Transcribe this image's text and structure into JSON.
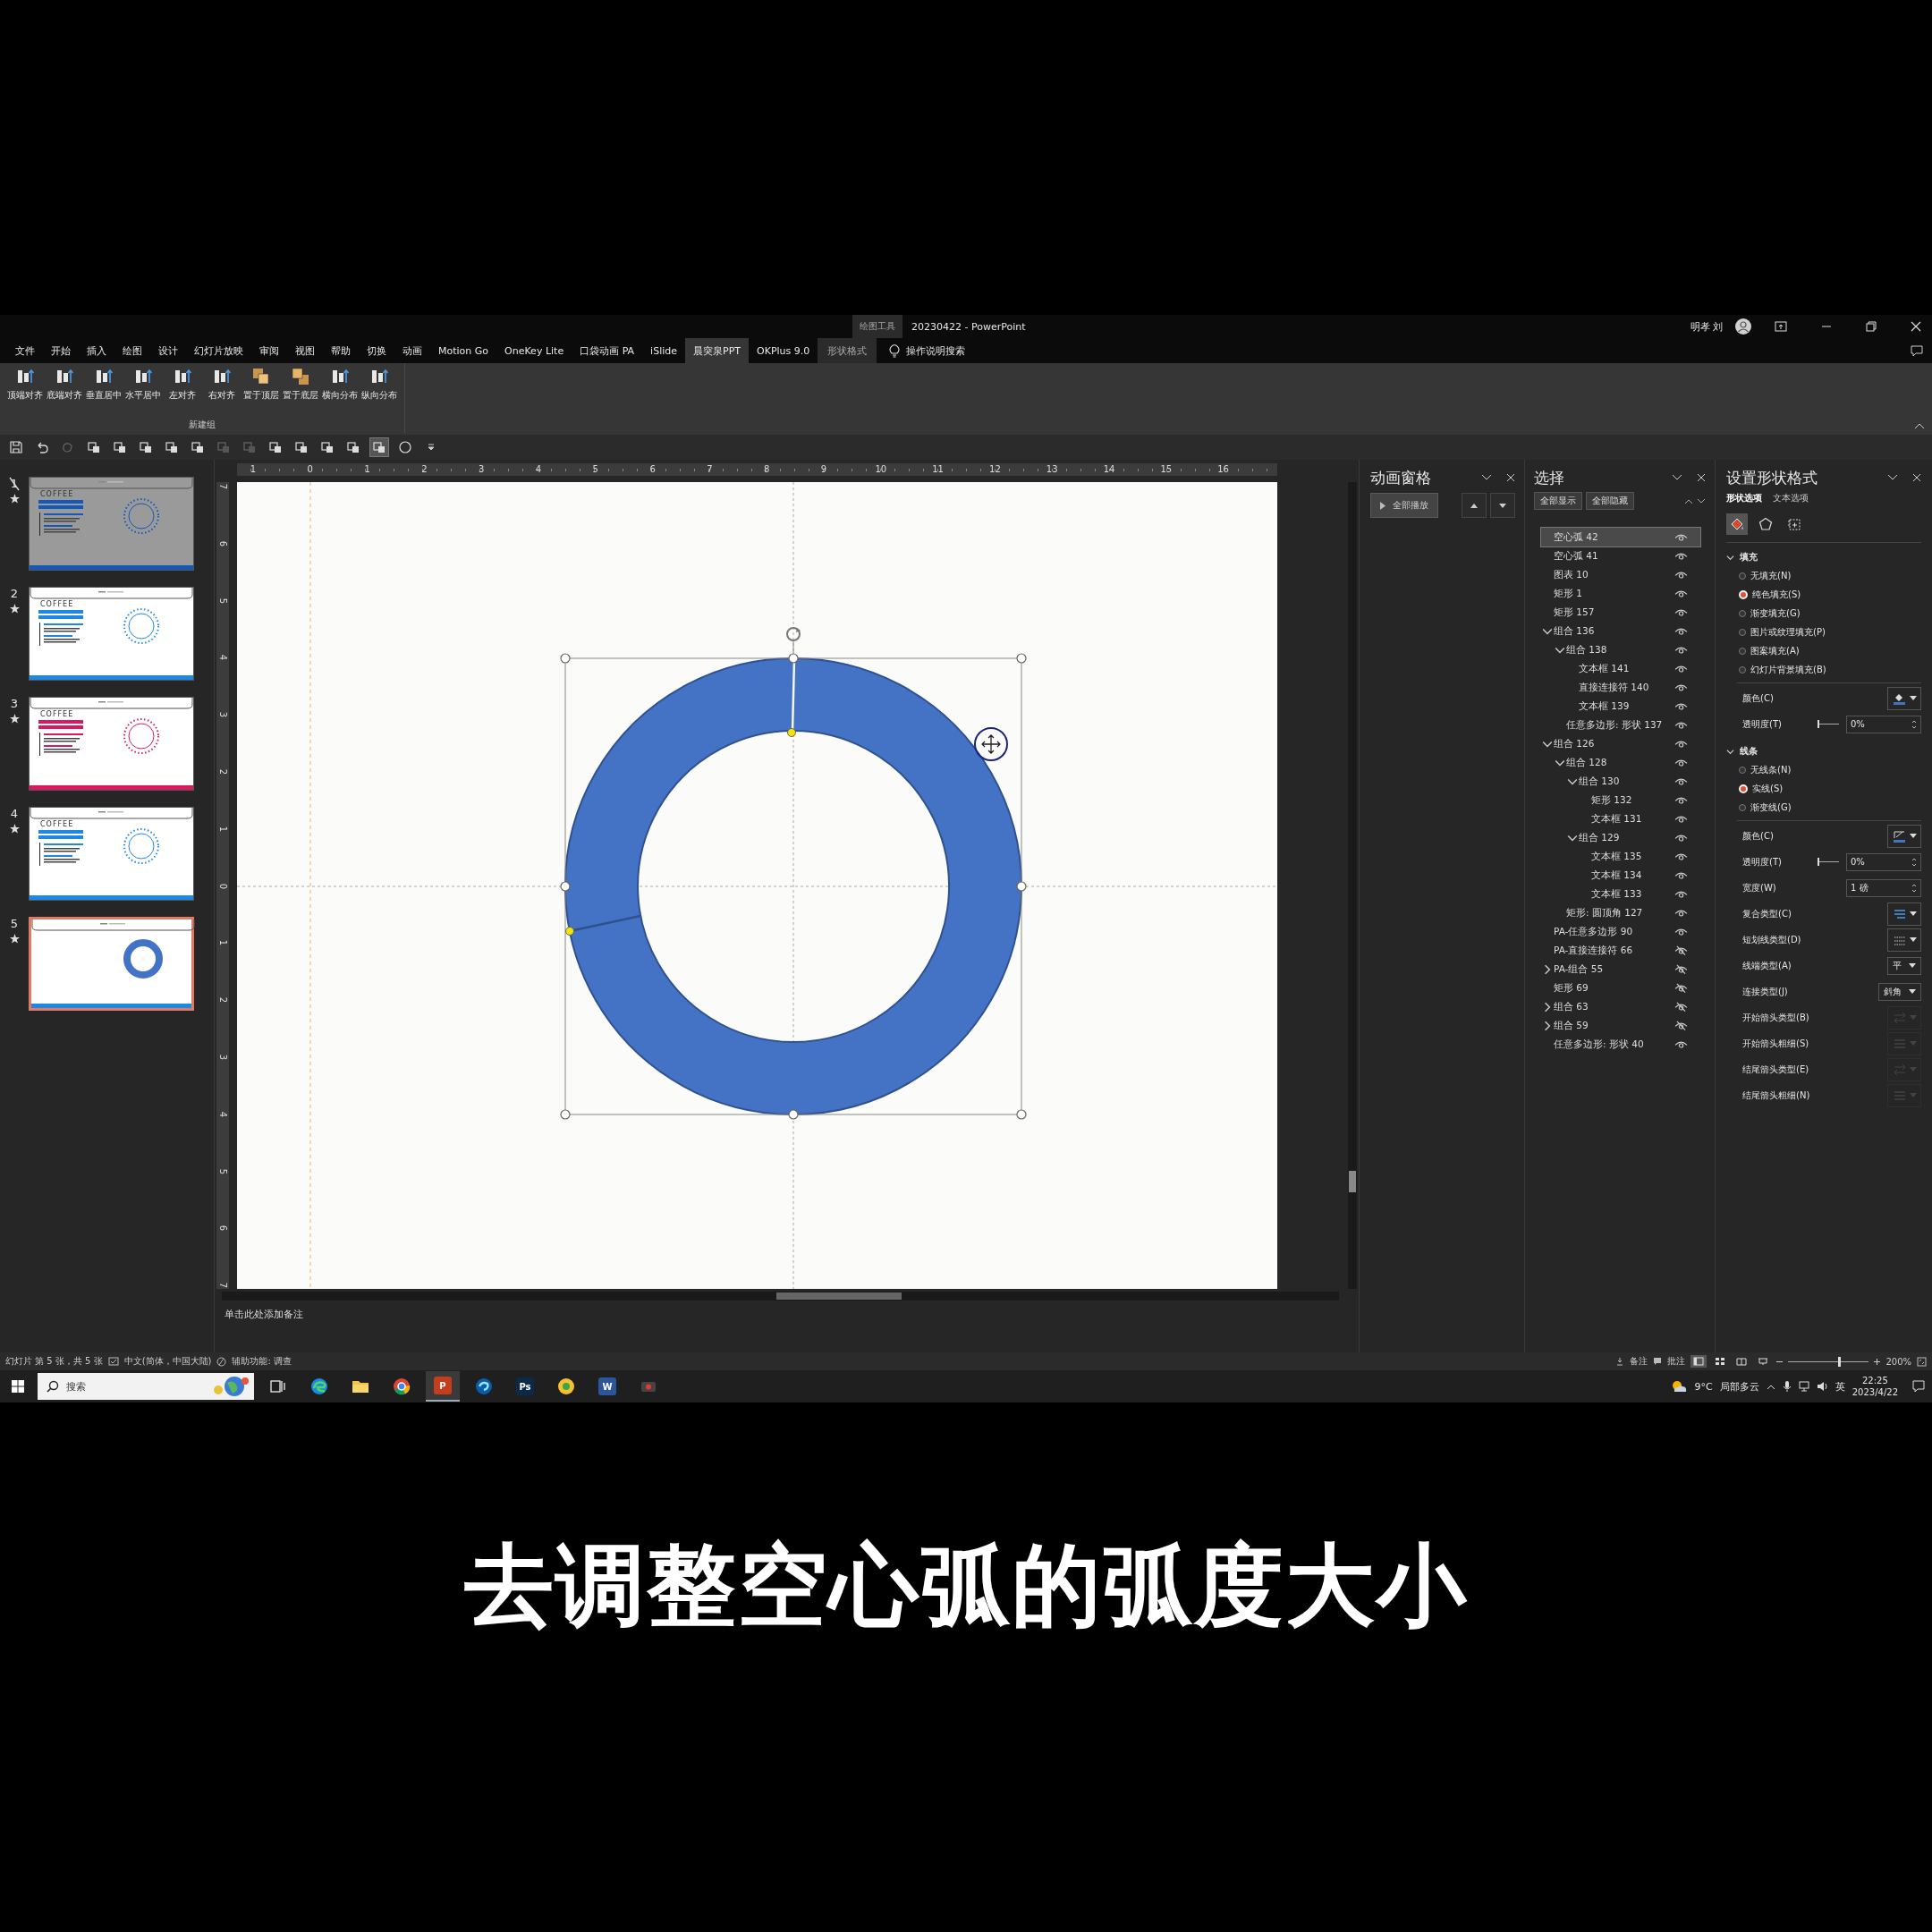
{
  "window": {
    "title": "20230422  -  PowerPoint",
    "context_group": "绘图工具",
    "user": "明孝 刘"
  },
  "menu_tabs": [
    {
      "label": "文件",
      "selected": false,
      "contextual": false
    },
    {
      "label": "开始",
      "selected": false,
      "contextual": false
    },
    {
      "label": "插入",
      "selected": false,
      "contextual": false
    },
    {
      "label": "绘图",
      "selected": false,
      "contextual": false
    },
    {
      "label": "设计",
      "selected": false,
      "contextual": false
    },
    {
      "label": "幻灯片放映",
      "selected": false,
      "contextual": false
    },
    {
      "label": "审阅",
      "selected": false,
      "contextual": false
    },
    {
      "label": "视图",
      "selected": false,
      "contextual": false
    },
    {
      "label": "帮助",
      "selected": false,
      "contextual": false
    },
    {
      "label": "切换",
      "selected": false,
      "contextual": false
    },
    {
      "label": "动画",
      "selected": false,
      "contextual": false
    },
    {
      "label": "Motion Go",
      "selected": false,
      "contextual": false
    },
    {
      "label": "OneKey Lite",
      "selected": false,
      "contextual": false
    },
    {
      "label": "口袋动画 PA",
      "selected": false,
      "contextual": false
    },
    {
      "label": "iSlide",
      "selected": false,
      "contextual": false
    },
    {
      "label": "晨突泉PPT",
      "selected": true,
      "contextual": false
    },
    {
      "label": "OKPlus 9.0",
      "selected": false,
      "contextual": false
    },
    {
      "label": "形状格式",
      "selected": false,
      "contextual": true
    }
  ],
  "tell_me": "操作说明搜索",
  "ribbon": {
    "buttons": [
      "顶端对齐",
      "底端对齐",
      "垂直居中",
      "水平居中",
      "左对齐",
      "右对齐",
      "置于顶层",
      "置于底层",
      "横向分布",
      "纵向分布"
    ],
    "group_label": "新建组"
  },
  "thumbnails": [
    {
      "number": "1",
      "kind": "cover",
      "hidden": true,
      "selected": false,
      "color": "#1458b8",
      "title": "COFFEE"
    },
    {
      "number": "2",
      "kind": "cover",
      "hidden": false,
      "selected": false,
      "color": "#1e88e5",
      "title": "COFFEE"
    },
    {
      "number": "3",
      "kind": "cover",
      "hidden": false,
      "selected": false,
      "color": "#d81b60",
      "title": "COFFEE"
    },
    {
      "number": "4",
      "kind": "cover",
      "hidden": false,
      "selected": false,
      "color": "#1e88e5",
      "title": "COFFEE"
    },
    {
      "number": "5",
      "kind": "donut",
      "hidden": false,
      "selected": true,
      "color": "#1e88e5"
    }
  ],
  "ruler": {
    "horizontal": [
      "1",
      "0",
      "1",
      "2",
      "3",
      "4",
      "5",
      "6",
      "7",
      "8",
      "9",
      "10",
      "11",
      "12",
      "13",
      "14",
      "15",
      "16"
    ],
    "vertical": [
      "7",
      "6",
      "5",
      "4",
      "3",
      "2",
      "1",
      "0",
      "1",
      "2",
      "3",
      "4",
      "5",
      "6",
      "7"
    ]
  },
  "notes_placeholder": "单击此处添加备注",
  "animation_pane": {
    "title": "动画窗格",
    "play_button": "全部播放"
  },
  "selection_pane": {
    "title": "选择",
    "show_all": "全部显示",
    "hide_all": "全部隐藏",
    "items": [
      {
        "name": "空心弧 42",
        "selected": true,
        "visible": true
      },
      {
        "name": "空心弧 41",
        "selected": false,
        "visible": true
      },
      {
        "name": "图表 10",
        "selected": false,
        "visible": true
      },
      {
        "name": "矩形 1",
        "selected": false,
        "visible": true
      },
      {
        "name": "矩形 157",
        "selected": false,
        "visible": true
      },
      {
        "name": "组合 136",
        "expanded": true,
        "selected": false,
        "visible": true,
        "children": [
          {
            "name": "组合 138",
            "expanded": true,
            "selected": false,
            "visible": true,
            "children": [
              {
                "name": "文本框 141",
                "selected": false,
                "visible": true
              },
              {
                "name": "直接连接符 140",
                "selected": false,
                "visible": true
              },
              {
                "name": "文本框 139",
                "selected": false,
                "visible": true
              }
            ]
          },
          {
            "name": "任意多边形: 形状 137",
            "selected": false,
            "visible": true
          }
        ]
      },
      {
        "name": "组合 126",
        "expanded": true,
        "selected": false,
        "visible": true,
        "children": [
          {
            "name": "组合 128",
            "expanded": true,
            "selected": false,
            "visible": true,
            "children": [
              {
                "name": "组合 130",
                "expanded": true,
                "selected": false,
                "visible": true,
                "children": [
                  {
                    "name": "矩形 132",
                    "selected": false,
                    "visible": true
                  },
                  {
                    "name": "文本框 131",
                    "selected": false,
                    "visible": true
                  }
                ]
              },
              {
                "name": "组合 129",
                "expanded": true,
                "selected": false,
                "visible": true,
                "children": [
                  {
                    "name": "文本框 135",
                    "selected": false,
                    "visible": true
                  },
                  {
                    "name": "文本框 134",
                    "selected": false,
                    "visible": true
                  },
                  {
                    "name": "文本框 133",
                    "selected": false,
                    "visible": true
                  }
                ]
              }
            ]
          },
          {
            "name": "矩形: 圆顶角 127",
            "selected": false,
            "visible": true
          }
        ]
      },
      {
        "name": "PA-任意多边形 90",
        "selected": false,
        "visible": true
      },
      {
        "name": "PA-直接连接符 66",
        "selected": false,
        "visible": false
      },
      {
        "name": "PA-组合 55",
        "expanded": false,
        "selected": false,
        "visible": false
      },
      {
        "name": "矩形 69",
        "selected": false,
        "visible": false
      },
      {
        "name": "组合 63",
        "expanded": false,
        "selected": false,
        "visible": false
      },
      {
        "name": "组合 59",
        "expanded": false,
        "selected": false,
        "visible": false
      },
      {
        "name": "任意多边形: 形状 40",
        "selected": false,
        "visible": true
      }
    ]
  },
  "format_pane": {
    "title": "设置形状格式",
    "tabs": [
      {
        "label": "形状选项",
        "selected": true
      },
      {
        "label": "文本选项",
        "selected": false
      }
    ],
    "icon_tabs": [
      {
        "kind": "fill",
        "selected": true
      },
      {
        "kind": "effects",
        "selected": false
      },
      {
        "kind": "size",
        "selected": false
      }
    ],
    "sections": [
      {
        "title": "填充",
        "expanded": true,
        "options": [
          {
            "label": "无填充(N)",
            "selected": false
          },
          {
            "label": "纯色填充(S)",
            "selected": true
          },
          {
            "label": "渐变填充(G)",
            "selected": false
          },
          {
            "label": "图片或纹理填充(P)",
            "selected": false
          },
          {
            "label": "图案填充(A)",
            "selected": false
          },
          {
            "label": "幻灯片背景填充(B)",
            "selected": false
          }
        ],
        "properties": [
          {
            "kind": "fill-color",
            "label": "颜色(C)"
          },
          {
            "kind": "slider",
            "label": "透明度(T)",
            "value": "0%",
            "level": 0
          }
        ]
      },
      {
        "title": "线条",
        "expanded": true,
        "options": [
          {
            "label": "无线条(N)",
            "selected": false
          },
          {
            "label": "实线(S)",
            "selected": true
          },
          {
            "label": "渐变线(G)",
            "selected": false
          }
        ],
        "properties": [
          {
            "kind": "line-color",
            "label": "颜色(C)"
          },
          {
            "kind": "slider",
            "label": "透明度(T)",
            "value": "0%",
            "level": 0
          },
          {
            "kind": "spin",
            "label": "宽度(W)",
            "value": "1 磅"
          },
          {
            "kind": "compound",
            "label": "复合类型(C)"
          },
          {
            "kind": "dash",
            "label": "短划线类型(D)"
          },
          {
            "kind": "dropdown",
            "label": "线端类型(A)",
            "value": "平"
          },
          {
            "kind": "dropdown",
            "label": "连接类型(J)",
            "value": "斜角"
          },
          {
            "kind": "arrow-type",
            "label": "开始箭头类型(B)",
            "disabled": true
          },
          {
            "kind": "arrow-size",
            "label": "开始箭头粗细(S)",
            "disabled": true
          },
          {
            "kind": "arrow-type",
            "label": "结尾箭头类型(E)",
            "disabled": true
          },
          {
            "kind": "arrow-size",
            "label": "结尾箭头粗细(N)",
            "disabled": true
          }
        ]
      }
    ]
  },
  "status_bar": {
    "slide_info": "幻灯片 第 5 张，共 5 张",
    "language": "中文(简体，中国大陆)",
    "accessibility": "辅助功能: 调查",
    "notes": "备注",
    "comments": "批注",
    "views": [
      {
        "kind": "normal",
        "selected": true
      },
      {
        "kind": "sorter",
        "selected": false
      },
      {
        "kind": "reading",
        "selected": false
      },
      {
        "kind": "slideshow",
        "selected": false
      }
    ],
    "zoom_slider": {
      "level": 0.62
    },
    "zoom": "200%"
  },
  "taskbar": {
    "search_placeholder": "搜索",
    "apps": [
      {
        "kind": "taskview",
        "selected": false
      },
      {
        "kind": "edge",
        "selected": false
      },
      {
        "kind": "files",
        "selected": false
      },
      {
        "kind": "chrome",
        "selected": false
      },
      {
        "kind": "powerpoint",
        "label": "P",
        "selected": true
      },
      {
        "kind": "edge-dev",
        "selected": false
      },
      {
        "kind": "photoshop",
        "label": "Ps",
        "selected": false
      },
      {
        "kind": "yellow-app",
        "selected": false
      },
      {
        "kind": "word",
        "label": "W",
        "selected": false
      },
      {
        "kind": "recorder",
        "selected": false
      }
    ],
    "temperature": "9°C",
    "weather": "局部多云",
    "ime": "英",
    "time": "22:25",
    "date": "2023/4/22"
  },
  "subtitle": "去调整空心弧的弧度大小"
}
